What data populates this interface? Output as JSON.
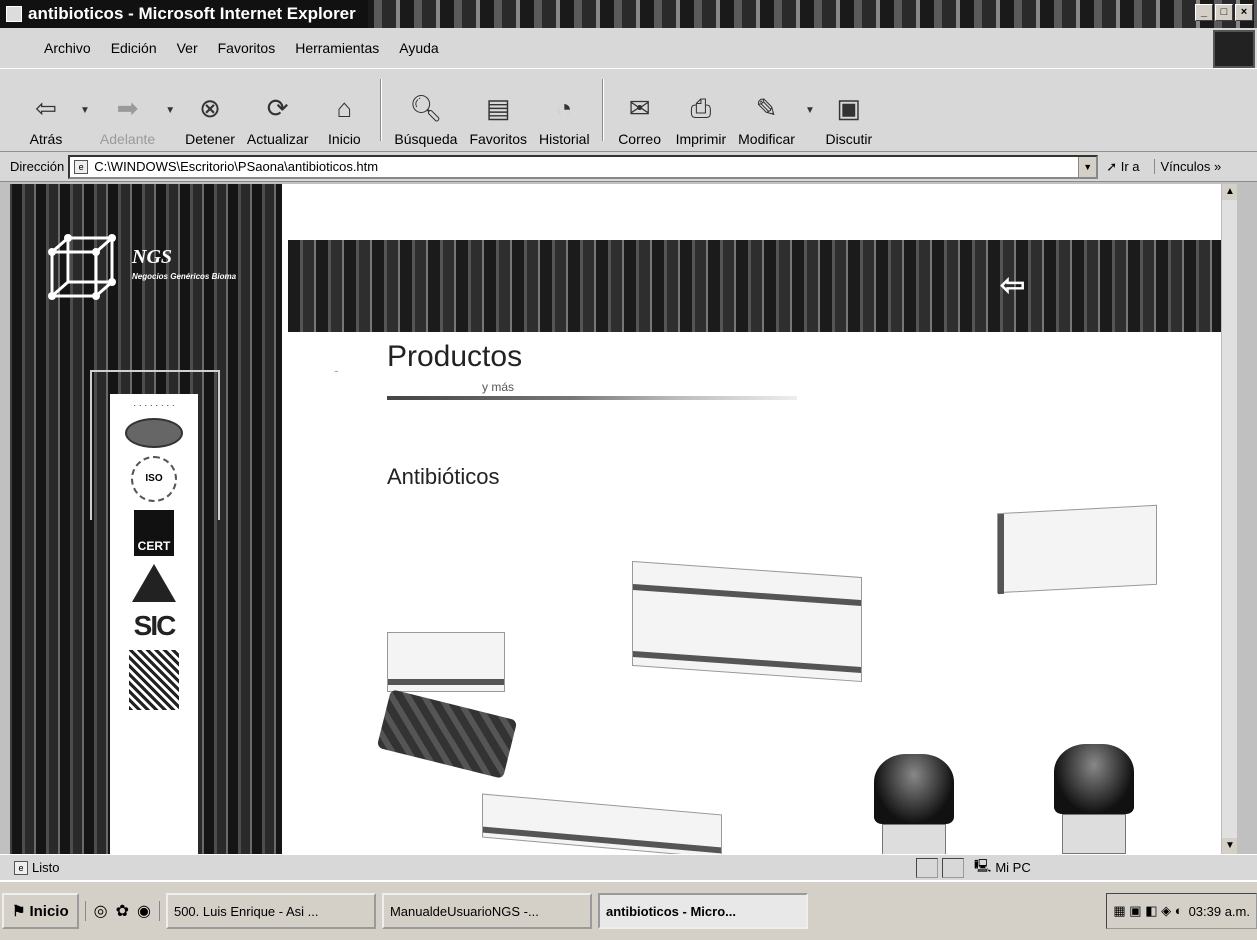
{
  "window": {
    "title": "antibioticos - Microsoft Internet Explorer"
  },
  "menu": {
    "items": [
      "Archivo",
      "Edición",
      "Ver",
      "Favoritos",
      "Herramientas",
      "Ayuda"
    ]
  },
  "toolbar": {
    "back": "Atrás",
    "forward": "Adelante",
    "stop": "Detener",
    "refresh": "Actualizar",
    "home": "Inicio",
    "search": "Búsqueda",
    "favorites": "Favoritos",
    "history": "Historial",
    "mail": "Correo",
    "print": "Imprimir",
    "edit": "Modificar",
    "discuss": "Discutir"
  },
  "address": {
    "label": "Dirección",
    "url": "C:\\WINDOWS\\Escritorio\\PSaona\\antibioticos.htm",
    "go": "Ir a",
    "links": "Vínculos"
  },
  "page": {
    "logo_text": "NGS",
    "logo_subtitle": "Negocios Genéricos Bioma",
    "heading": "Productos",
    "heading_sub": "y más",
    "section": "Antibióticos",
    "cert_ccert": "CERT",
    "cert_sic": "SIC",
    "cert_iso": "ISO"
  },
  "status": {
    "text": "Listo",
    "zone": "Mi PC"
  },
  "taskbar": {
    "start": "Inicio",
    "tasks": [
      "500. Luis Enrique - Asi ...",
      "ManualdeUsuarioNGS -...",
      "antibioticos - Micro..."
    ],
    "clock": "03:39 a.m."
  }
}
